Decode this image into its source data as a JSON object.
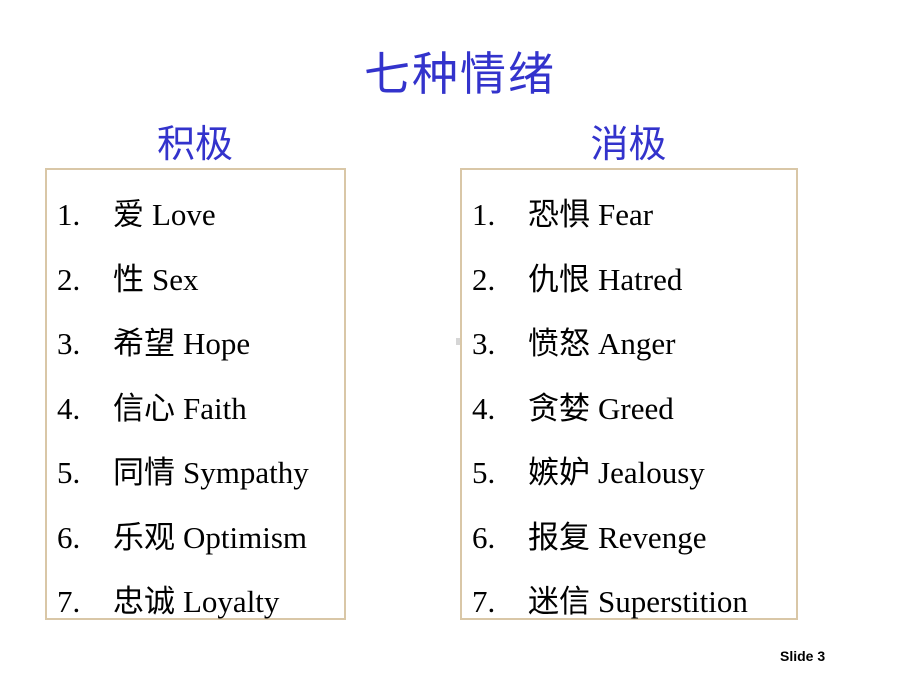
{
  "slide": {
    "title": "七种情绪",
    "slide_label": "Slide 3",
    "accent_color": "#3333cc",
    "box_border_color": "#d9c7a7"
  },
  "positive": {
    "heading": "积极",
    "items": [
      {
        "num": "1.",
        "cn": "爱",
        "en": "Love"
      },
      {
        "num": "2.",
        "cn": "性",
        "en": "Sex"
      },
      {
        "num": "3.",
        "cn": "希望",
        "en": "Hope"
      },
      {
        "num": "4.",
        "cn": "信心",
        "en": "Faith"
      },
      {
        "num": "5.",
        "cn": "同情",
        "en": "Sympathy"
      },
      {
        "num": "6.",
        "cn": "乐观",
        "en": "Optimism"
      },
      {
        "num": "7.",
        "cn": "忠诚",
        "en": "Loyalty"
      }
    ]
  },
  "negative": {
    "heading": "消极",
    "items": [
      {
        "num": "1.",
        "cn": "恐惧",
        "en": "Fear"
      },
      {
        "num": "2.",
        "cn": "仇恨",
        "en": "Hatred"
      },
      {
        "num": "3.",
        "cn": "愤怒",
        "en": "Anger"
      },
      {
        "num": "4.",
        "cn": "贪婪",
        "en": "Greed"
      },
      {
        "num": "5.",
        "cn": "嫉妒",
        "en": "Jealousy"
      },
      {
        "num": "6.",
        "cn": "报复",
        "en": "Revenge"
      },
      {
        "num": "7.",
        "cn": "迷信",
        "en": "Superstition"
      }
    ]
  }
}
